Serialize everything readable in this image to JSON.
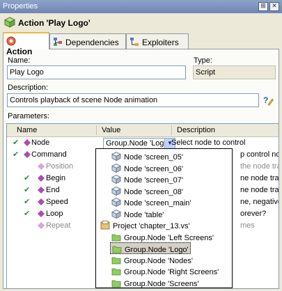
{
  "window": {
    "title": "Properties",
    "pin_glyph": "⊞",
    "close_glyph": "✕"
  },
  "header": {
    "title": "Action 'Play Logo'",
    "icon": "action-cube-icon"
  },
  "tabs": [
    {
      "label": "Action",
      "icon": "action-tab-icon",
      "active": true
    },
    {
      "label": "Dependencies",
      "icon": "dependencies-icon",
      "active": false
    },
    {
      "label": "Exploiters",
      "icon": "exploiters-icon",
      "active": false
    }
  ],
  "form": {
    "name_label": "Name:",
    "name_value": "Play Logo",
    "type_label": "Type:",
    "type_value": "Script",
    "description_label": "Description:",
    "description_value": "Controls playback of scene Node animation",
    "parameters_label": "Parameters:"
  },
  "grid": {
    "columns": [
      "Name",
      "Value",
      "Description"
    ],
    "rows": [
      {
        "check": "✔",
        "name": "Node",
        "value": "Group.Node 'Logo'",
        "description": "Select node to control",
        "dim": false
      },
      {
        "check": "✔",
        "name": "Command",
        "value": "",
        "description": "p control noc",
        "dim": false
      },
      {
        "check": "",
        "name": "Position",
        "value": "",
        "description": "the node trac",
        "dim": true
      },
      {
        "check": "✔",
        "name": "Begin",
        "value": "",
        "description": "ne node track",
        "dim": false
      },
      {
        "check": "✔",
        "name": "End",
        "value": "",
        "description": "ne node track",
        "dim": false
      },
      {
        "check": "✔",
        "name": "Speed",
        "value": "",
        "description": "ne, negative, p",
        "dim": false
      },
      {
        "check": "✔",
        "name": "Loop",
        "value": "",
        "description": "orever?",
        "dim": false
      },
      {
        "check": "",
        "name": "Repeat",
        "value": "",
        "description": "mes",
        "dim": true
      }
    ]
  },
  "dropdown": {
    "scroll_up": "▲",
    "scroll_down": "▼",
    "items": [
      {
        "label": "Node 'screen_05'",
        "icon": "node-cube-icon",
        "indent": 1,
        "selected": false
      },
      {
        "label": "Node 'screen_06'",
        "icon": "node-cube-icon",
        "indent": 1,
        "selected": false
      },
      {
        "label": "Node 'screen_07'",
        "icon": "node-cube-icon",
        "indent": 1,
        "selected": false
      },
      {
        "label": "Node 'screen_08'",
        "icon": "node-cube-icon",
        "indent": 1,
        "selected": false
      },
      {
        "label": "Node 'screen_main'",
        "icon": "node-cube-icon",
        "indent": 1,
        "selected": false
      },
      {
        "label": "Node 'table'",
        "icon": "node-cube-icon",
        "indent": 1,
        "selected": false
      },
      {
        "label": "Project 'chapter_13.vs'",
        "icon": "project-icon",
        "indent": 0,
        "selected": false
      },
      {
        "label": "Group.Node 'Left Screens'",
        "icon": "folder-icon",
        "indent": 1,
        "selected": false
      },
      {
        "label": "Group.Node 'Logo'",
        "icon": "folder-icon",
        "indent": 1,
        "selected": true
      },
      {
        "label": "Group.Node 'Nodes'",
        "icon": "folder-icon",
        "indent": 1,
        "selected": false
      },
      {
        "label": "Group.Node 'Right Screens'",
        "icon": "folder-icon",
        "indent": 1,
        "selected": false
      },
      {
        "label": "Group.Node 'Screens'",
        "icon": "folder-icon",
        "indent": 1,
        "selected": false
      }
    ]
  },
  "colors": {
    "accent_tab": "#f9b43a",
    "check": "#2e8b2e",
    "folder": "#7fbf4a",
    "param": "#b04ab0"
  }
}
